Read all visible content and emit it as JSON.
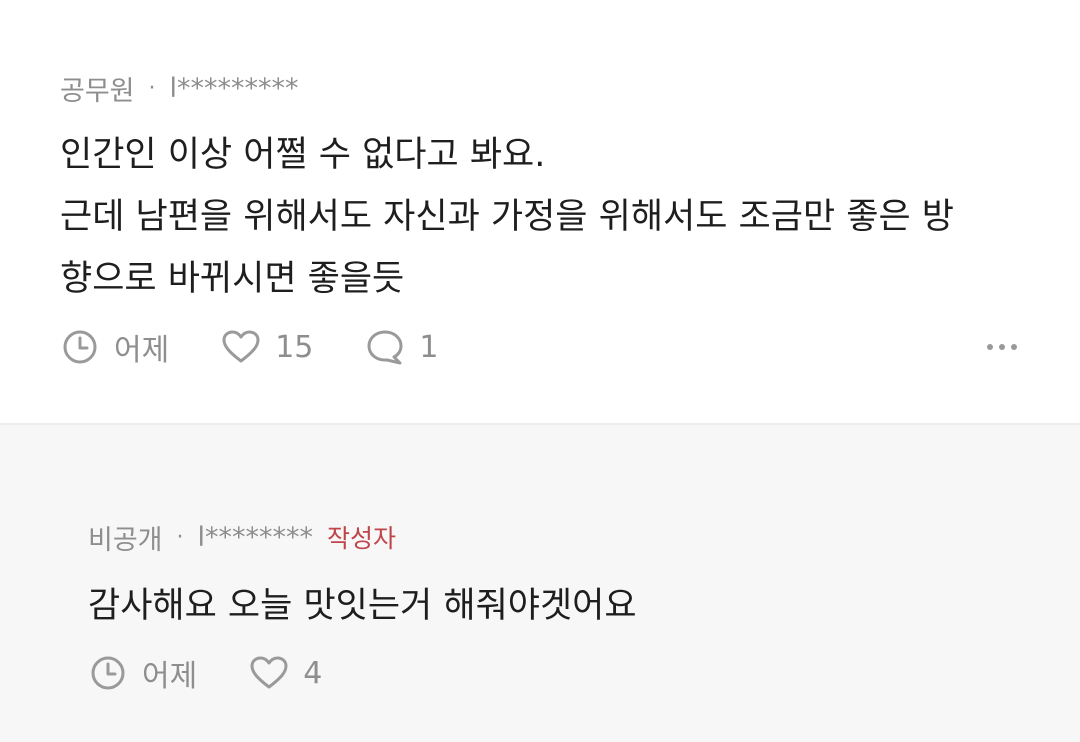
{
  "comments": [
    {
      "author": "공무원",
      "separator": "·",
      "user_id": "l*********",
      "lines": [
        "인간인 이상 어쩔 수 없다고 봐요.",
        "근데 남편을 위해서도 자신과 가정을 위해서도 조금만 좋은 방",
        "향으로 바뀌시면 좋을듯"
      ],
      "time": "어제",
      "likes": "15",
      "replies": "1",
      "more_icon": "more-horizontal-icon"
    },
    {
      "author": "비공개",
      "separator": "·",
      "user_id": "l********",
      "author_tag": "작성자",
      "author_tag_color": "#c0454a",
      "lines": [
        "감사해요 오늘 맛잇는거 해줘야겟어요"
      ],
      "time": "어제",
      "likes": "4"
    }
  ],
  "icons": {
    "time": "clock-icon",
    "like": "heart-icon",
    "reply": "speech-bubble-icon"
  },
  "colors": {
    "meta_text": "#8e8e8e",
    "body_text": "#1e1e1e",
    "reply_bg": "#f7f7f7",
    "divider": "#ececec"
  }
}
